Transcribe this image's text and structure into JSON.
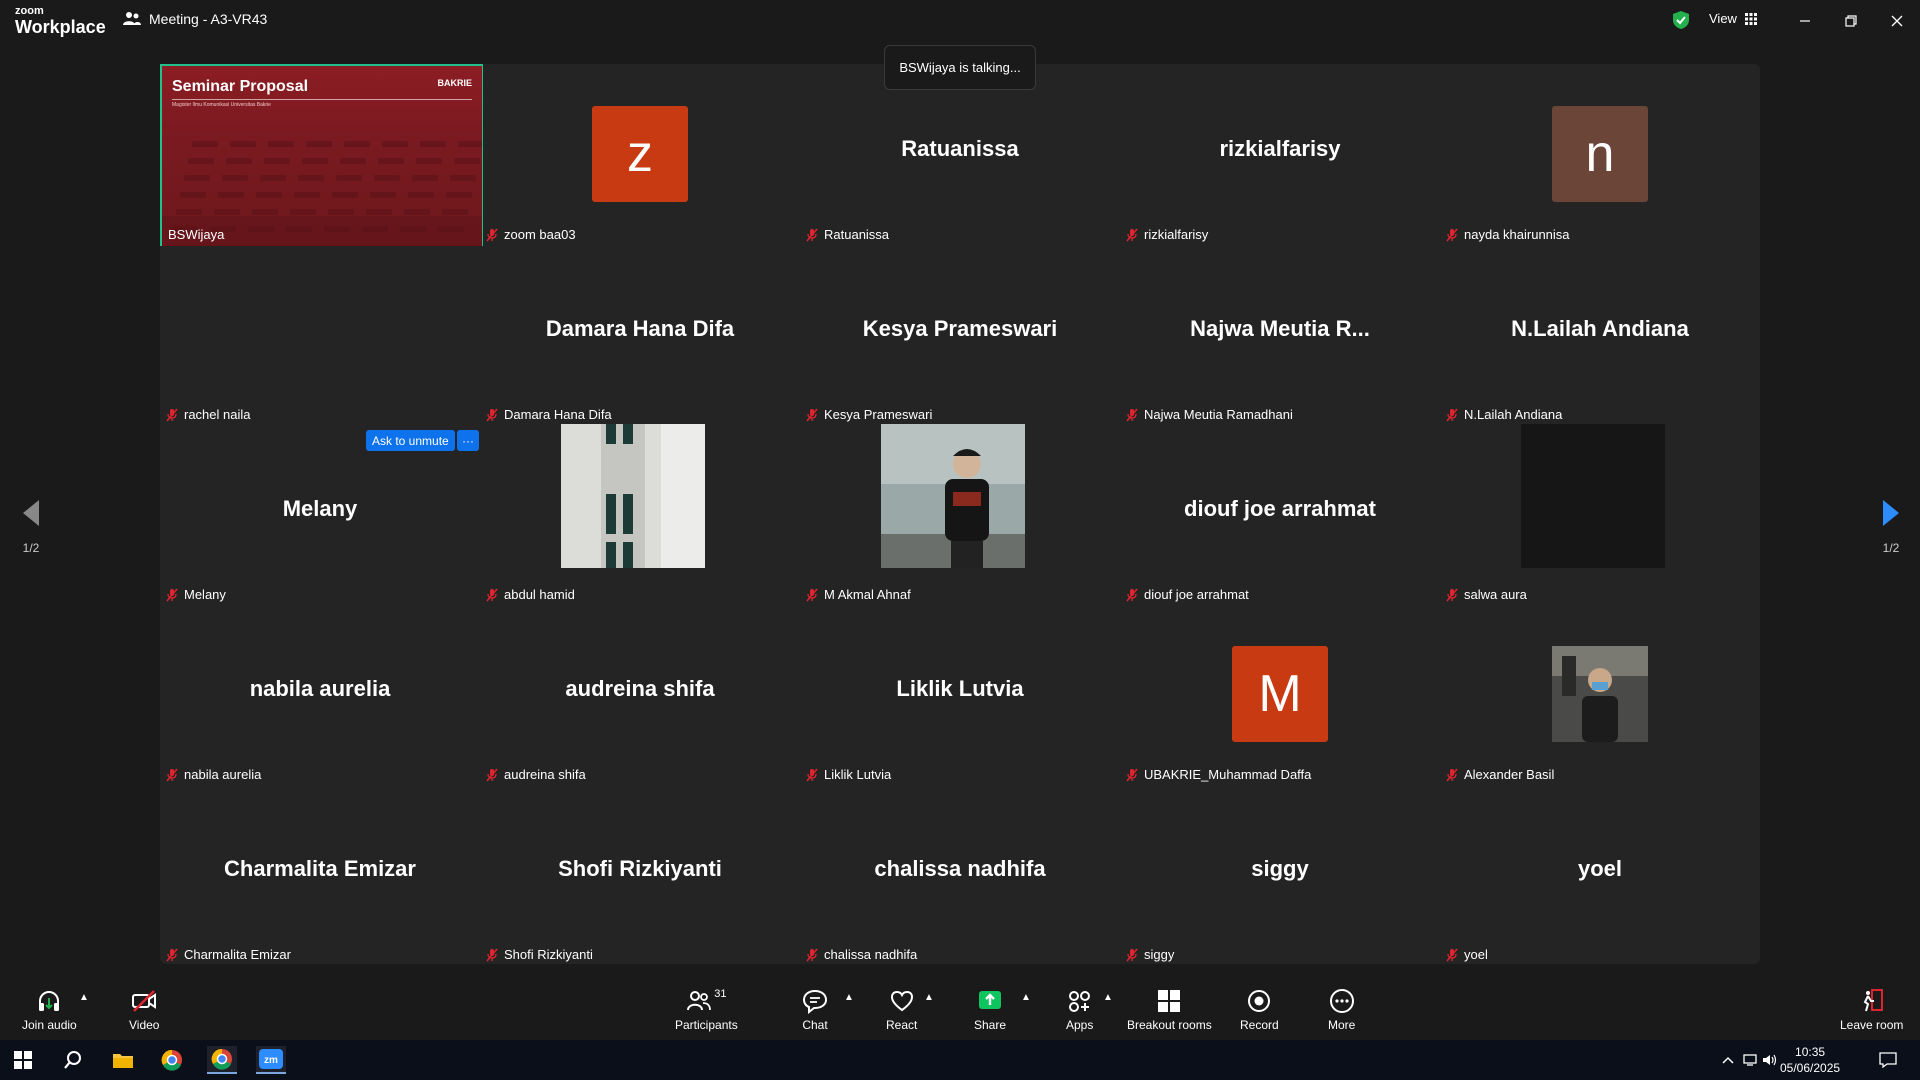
{
  "app": {
    "logo_small": "zoom",
    "logo_big": "Workplace",
    "meeting_title": "Meeting - A3-VR43",
    "view_label": "View"
  },
  "talking_banner": "BSWijaya is talking...",
  "slide": {
    "title": "Seminar Proposal",
    "subtitle": "Magister Ilmu Komunikasi Universitas Bakrie",
    "brand": "BAKRIE"
  },
  "tiles": [
    {
      "name": "BSWijaya",
      "center": "",
      "type": "slide"
    },
    {
      "name": "zoom baa03",
      "center": "",
      "type": "avatar",
      "letter": "z",
      "color": "#c73a12"
    },
    {
      "name": "Ratuanissa",
      "center": "Ratuanissa",
      "type": "text"
    },
    {
      "name": "rizkialfarisy",
      "center": "rizkialfarisy",
      "type": "text"
    },
    {
      "name": "nayda khairunnisa",
      "center": "",
      "type": "avatar",
      "letter": "n",
      "color": "#6b4537"
    },
    {
      "name": "rachel naila",
      "center": "",
      "type": "text"
    },
    {
      "name": "Damara Hana Difa",
      "center": "Damara Hana Difa",
      "type": "text"
    },
    {
      "name": "Kesya Prameswari",
      "center": "Kesya Prameswari",
      "type": "text"
    },
    {
      "name": "Najwa Meutia Ramadhani",
      "center": "Najwa Meutia R...",
      "type": "text"
    },
    {
      "name": "N.Lailah Andiana",
      "center": "N.Lailah Andiana",
      "type": "text"
    },
    {
      "name": "Melany",
      "center": "Melany",
      "type": "text"
    },
    {
      "name": "abdul hamid",
      "center": "",
      "type": "video-building"
    },
    {
      "name": "M Akmal Ahnaf",
      "center": "",
      "type": "video-person"
    },
    {
      "name": "diouf joe arrahmat",
      "center": "diouf joe arrahmat",
      "type": "text"
    },
    {
      "name": "salwa aura",
      "center": "",
      "type": "video-dark"
    },
    {
      "name": "nabila aurelia",
      "center": "nabila aurelia",
      "type": "text"
    },
    {
      "name": "audreina shifa",
      "center": "audreina shifa",
      "type": "text"
    },
    {
      "name": "Liklik Lutvia",
      "center": "Liklik Lutvia",
      "type": "text"
    },
    {
      "name": "UBAKRIE_Muhammad Daffa",
      "center": "",
      "type": "avatar",
      "letter": "M",
      "color": "#c73a12"
    },
    {
      "name": "Alexander Basil",
      "center": "",
      "type": "video-small"
    },
    {
      "name": "Charmalita Emizar",
      "center": "Charmalita Emizar",
      "type": "text"
    },
    {
      "name": "Shofi Rizkiyanti",
      "center": "Shofi Rizkiyanti",
      "type": "text"
    },
    {
      "name": "chalissa nadhifa",
      "center": "chalissa nadhifa",
      "type": "text"
    },
    {
      "name": "siggy",
      "center": "siggy",
      "type": "text"
    },
    {
      "name": "yoel",
      "center": "yoel",
      "type": "text"
    }
  ],
  "ask_unmute": "Ask to unmute",
  "more_dots": "···",
  "page_indicator": "1/2",
  "toolbar": {
    "join_audio": "Join audio",
    "video": "Video",
    "participants": "Participants",
    "participants_count": "31",
    "chat": "Chat",
    "react": "React",
    "share": "Share",
    "apps": "Apps",
    "breakout": "Breakout rooms",
    "record": "Record",
    "more": "More",
    "leave": "Leave room"
  },
  "taskbar": {
    "time": "10:35",
    "date": "05/06/2025"
  }
}
